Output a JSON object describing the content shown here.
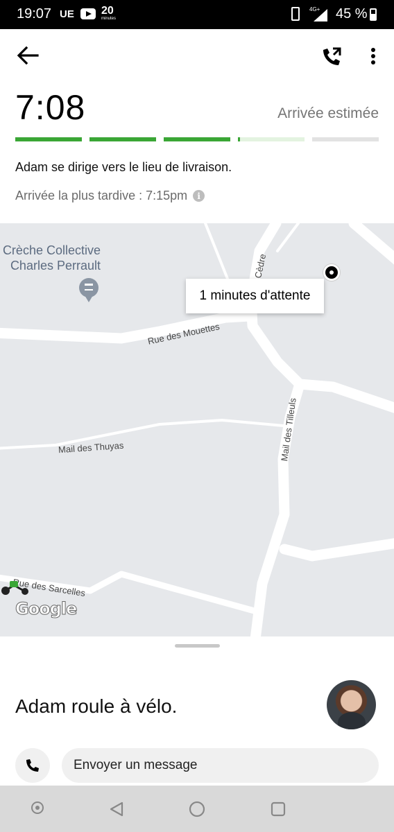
{
  "status_bar": {
    "time": "19:07",
    "carrier": "UE",
    "app_badge": "20",
    "app_badge_sub": "minutes",
    "network": "4G+",
    "battery": "45 %"
  },
  "header": {
    "eta_time": "7:08",
    "eta_label": "Arrivée estimée",
    "progress_fraction": 0.62,
    "status_message": "Adam se dirige vers le lieu de livraison.",
    "latest_arrival": "Arrivée la plus tardive : 7:15pm"
  },
  "map": {
    "poi_name": "Crèche Collective Charles Perrault",
    "wait_bubble": "1 minutes d'attente",
    "streets": {
      "mouettes": "Rue des Mouettes",
      "cedre": "P. du Cèdre",
      "tilleuls": "Mail des Tilleuls",
      "thuyas": "Mail des Thuyas",
      "sarcelles": "Rue des Sarcelles"
    },
    "attribution": "Google"
  },
  "sheet": {
    "rider_text": "Adam roule à vélo.",
    "message_placeholder": "Envoyer un message"
  },
  "icons": {
    "back": "arrow-left-icon",
    "call": "phone-icon",
    "more": "more-vertical-icon"
  },
  "colors": {
    "progress_done": "#3aa635",
    "progress_pending": "#e2e2e2"
  }
}
